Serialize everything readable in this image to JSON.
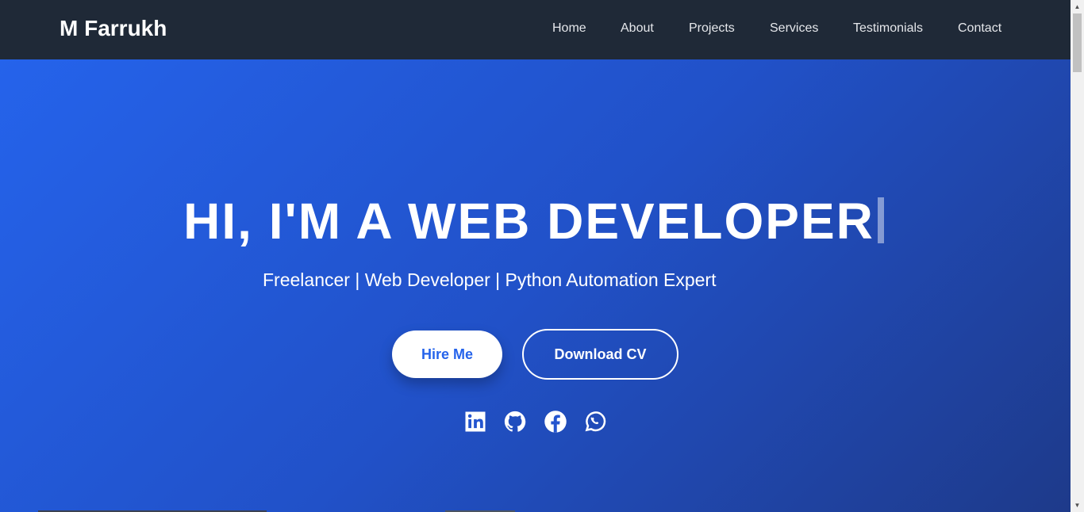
{
  "header": {
    "brand": "M Farrukh",
    "nav": [
      {
        "label": "Home"
      },
      {
        "label": "About"
      },
      {
        "label": "Projects"
      },
      {
        "label": "Services"
      },
      {
        "label": "Testimonials"
      },
      {
        "label": "Contact"
      }
    ]
  },
  "hero": {
    "title": "HI, I'M A WEB DEVELOPER",
    "subtitle": "Freelancer | Web Developer | Python Automation Expert",
    "hire_label": "Hire Me",
    "cv_label": "Download CV",
    "socials": [
      {
        "icon": "linkedin-icon"
      },
      {
        "icon": "github-icon"
      },
      {
        "icon": "facebook-icon"
      },
      {
        "icon": "whatsapp-icon"
      }
    ]
  },
  "colors": {
    "nav_bg": "#1f2937",
    "hero_gradient_start": "#2563eb",
    "hero_gradient_end": "#1e3a8a",
    "accent": "#2563eb"
  }
}
